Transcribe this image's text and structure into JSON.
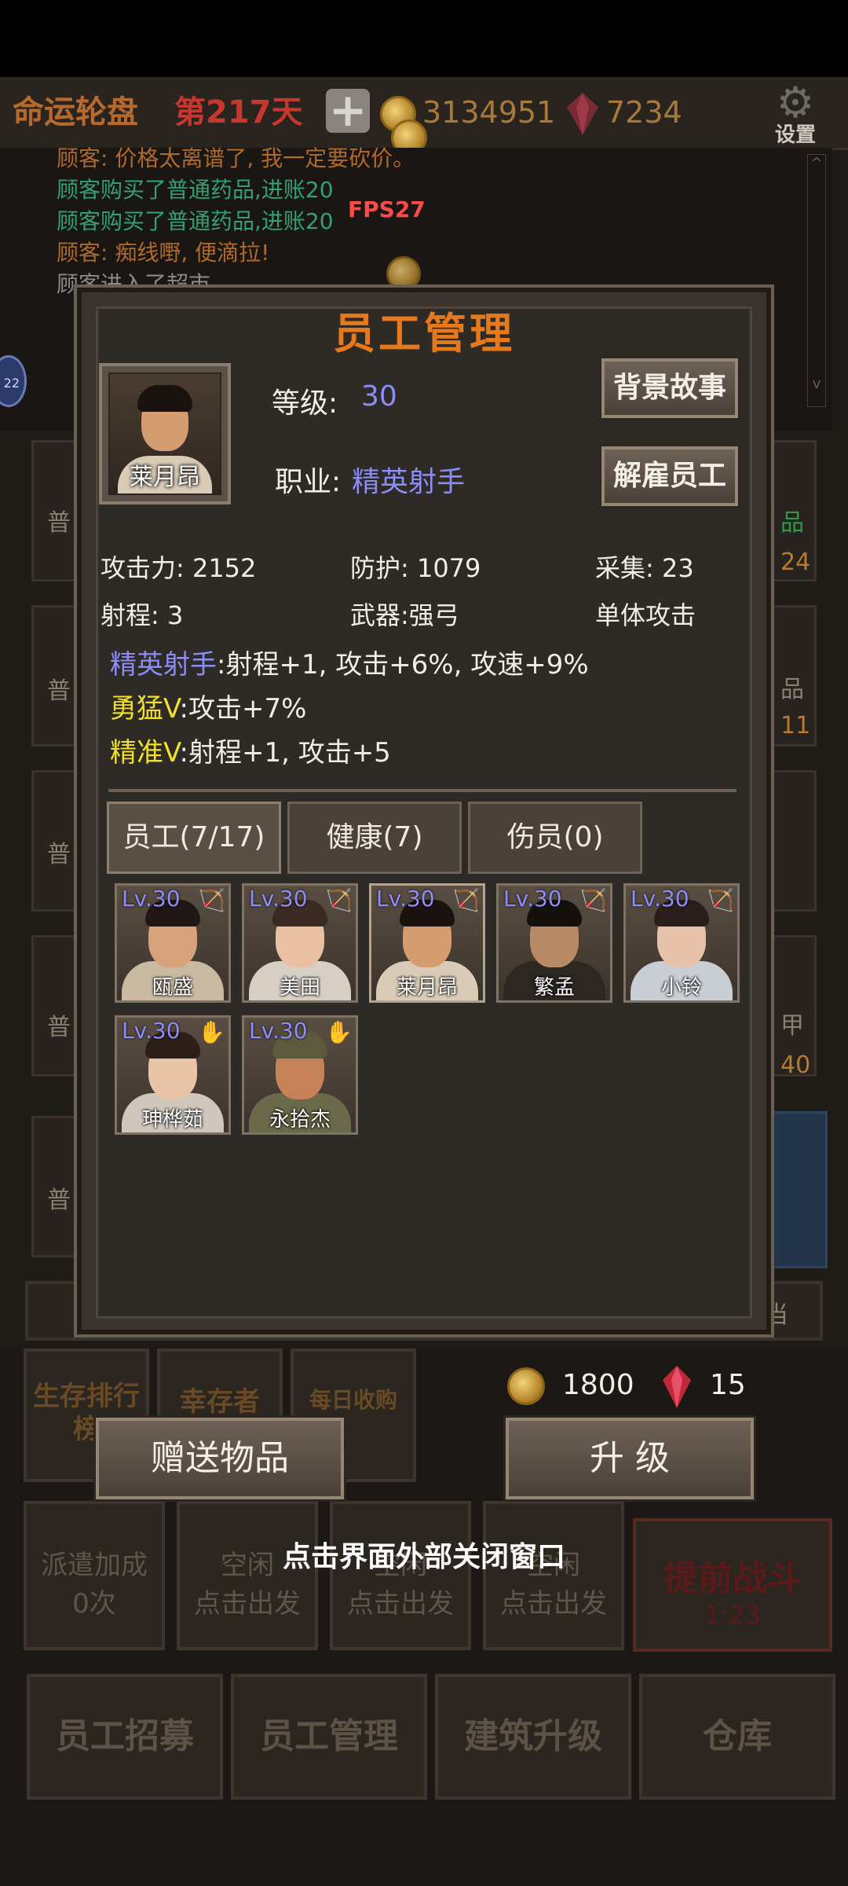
{
  "header": {
    "game_title": "命运轮盘",
    "day": "第217天",
    "gold": "3134951",
    "gems": "7234",
    "settings_label": "设置"
  },
  "log": [
    {
      "text": "顾客: 价格太离谱了, 我一定要砍价。",
      "color": "#b06a28"
    },
    {
      "text": "顾客购买了普通药品,进账20",
      "color": "#2fa07a"
    },
    {
      "text": "顾客购买了普通药品,进账20",
      "color": "#2fa07a"
    },
    {
      "text": "顾客: 痴线嘢, 便滴拉!",
      "color": "#b06a28"
    },
    {
      "text": "顾客进入了超市",
      "color": "#8a8a8a"
    }
  ],
  "fps": "FPS27",
  "background": {
    "row_tags": [
      "普",
      "普",
      "普",
      "普",
      "普"
    ],
    "right_tags": [
      "品",
      "24",
      "品",
      "11",
      "甲",
      "40"
    ],
    "bottom_buttons": {
      "survival_rank": "生存排行榜",
      "survivor": "幸存者",
      "daily_income": "每日收购",
      "dispatch_bonus": "派遣加成",
      "dispatch_count": "0次",
      "slot_idle": "空闲",
      "slot_go": "点击出发",
      "early_battle": "提前战斗",
      "battle_timer": "1:23",
      "nav": [
        "员工招募",
        "员工管理",
        "建筑升级",
        "仓库"
      ]
    }
  },
  "modal": {
    "title": "员工管理",
    "selected": {
      "name": "莱月昂",
      "level_label": "等级:",
      "level": "30",
      "class_label": "职业:",
      "class": "精英射手"
    },
    "buttons": {
      "backstory": "背景故事",
      "fire": "解雇员工",
      "gift": "赠送物品",
      "upgrade": "升 级"
    },
    "stats": {
      "attack": "攻击力: 2152",
      "defense": "防护: 1079",
      "gather": "采集: 23",
      "range": "射程: 3",
      "weapon": "武器:强弓",
      "target": "单体攻击"
    },
    "skills": [
      {
        "name": "精英射手",
        "desc": ":射程+1, 攻击+6%, 攻速+9%",
        "color": "#8c8cf6"
      },
      {
        "name": "勇猛V",
        "desc": ":攻击+7%",
        "color": "#f0e02a"
      },
      {
        "name": "精准V",
        "desc": ":射程+1, 攻击+5",
        "color": "#f0e02a"
      }
    ],
    "tabs": [
      "员工(7/17)",
      "健康(7)",
      "伤员(0)"
    ],
    "employees": [
      {
        "name": "瓯盛",
        "level": "Lv.30",
        "icon": "bow-icon",
        "skin": "#d7a27a",
        "coat": "#c9b9a0",
        "hair": "#1f1713"
      },
      {
        "name": "美田",
        "level": "Lv.30",
        "icon": "bow-icon",
        "skin": "#eac0a2",
        "coat": "#d8cfc4",
        "hair": "#3a2a22"
      },
      {
        "name": "莱月昂",
        "level": "Lv.30",
        "icon": "bow-icon",
        "skin": "#d59c70",
        "coat": "#d9cbb6",
        "hair": "#1a120e"
      },
      {
        "name": "繁孟",
        "level": "Lv.30",
        "icon": "bow-icon",
        "skin": "#b98a66",
        "coat": "#2d2722",
        "hair": "#15100c"
      },
      {
        "name": "小铃",
        "level": "Lv.30",
        "icon": "bow-icon",
        "skin": "#e6c2aa",
        "coat": "#c9ced4",
        "hair": "#2a1e1a"
      },
      {
        "name": "珅桦茹",
        "level": "Lv.30",
        "icon": "glove-icon",
        "skin": "#e9c3a6",
        "coat": "#cfc6bc",
        "hair": "#2c1f19"
      },
      {
        "name": "永拾杰",
        "level": "Lv.30",
        "icon": "glove-icon",
        "skin": "#c58258",
        "coat": "#6a6a4a",
        "hair": "#5b5a3c"
      }
    ],
    "costs": {
      "gold": "1800",
      "gems": "15"
    },
    "close_hint": "点击界面外部关闭窗口"
  }
}
